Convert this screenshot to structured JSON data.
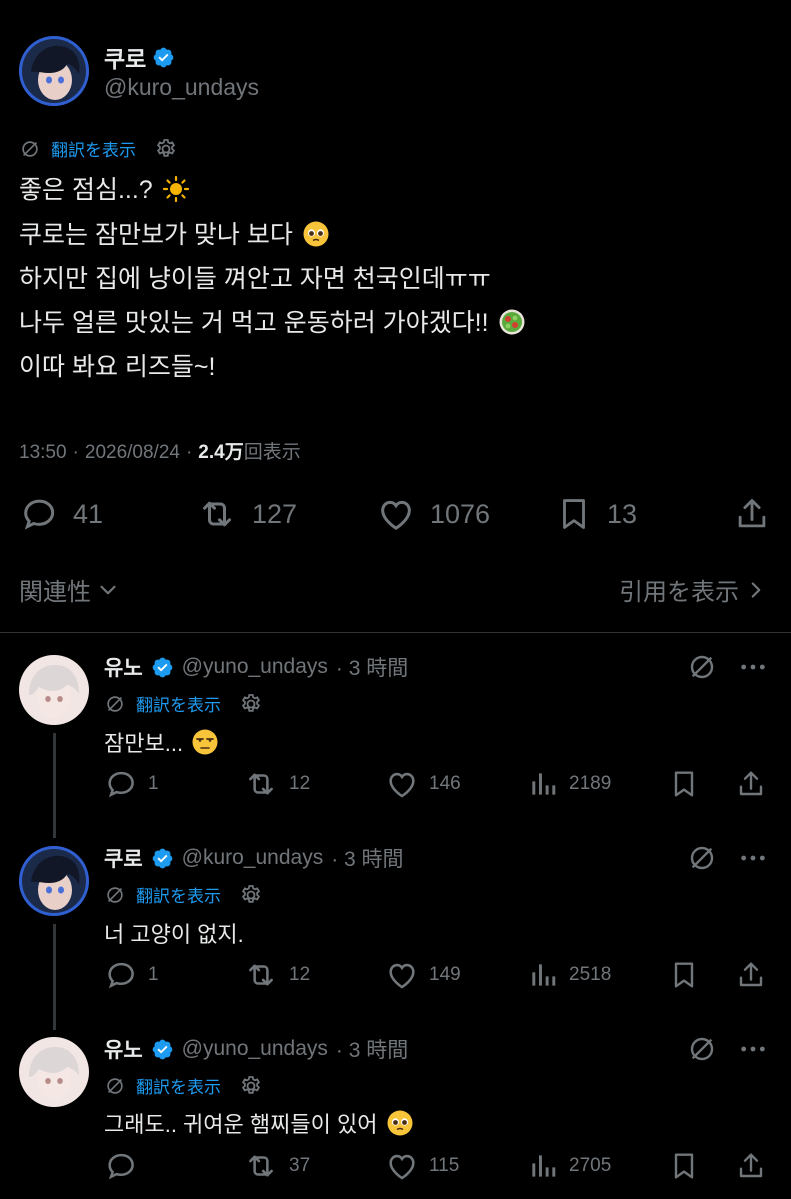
{
  "main_tweet": {
    "author_name": "쿠로",
    "author_handle": "@kuro_undays",
    "translate_label": "翻訳を表示",
    "lines": [
      "좋은 점심...?",
      "쿠로는 잠만보가 맞나 보다",
      "하지만 집에 냥이들 껴안고 자면 천국인데ㅠㅠ",
      "나두 얼른 맛있는 거 먹고 운동하러 가야겠다!!",
      "이따 봐요 리즈들~!"
    ],
    "time": "13:50",
    "date": "2026/08/24",
    "dot": "·",
    "views_count": "2.4万",
    "views_label": "回表示",
    "replies": "41",
    "reposts": "127",
    "likes": "1076",
    "bookmarks": "13"
  },
  "sort": {
    "relevance_label": "関連性",
    "quotes_label": "引用を表示"
  },
  "replies": [
    {
      "name": "유노",
      "handle": "@yuno_undays",
      "time": "· 3 時間",
      "translate_label": "翻訳を表示",
      "text": "잠만보...",
      "replies": "1",
      "reposts": "12",
      "likes": "146",
      "views": "2189"
    },
    {
      "name": "쿠로",
      "handle": "@kuro_undays",
      "time": "· 3 時間",
      "translate_label": "翻訳を表示",
      "text": "너 고양이 없지.",
      "replies": "1",
      "reposts": "12",
      "likes": "149",
      "views": "2518"
    },
    {
      "name": "유노",
      "handle": "@yuno_undays",
      "time": "· 3 時間",
      "translate_label": "翻訳を表示",
      "text": "그래도.. 귀여운 햄찌들이 있어",
      "replies": "",
      "reposts": "37",
      "likes": "115",
      "views": "2705"
    }
  ],
  "colors": {
    "background": "#000000",
    "accent": "#1d9bf0",
    "muted": "#71767b",
    "text": "#e7e9ea"
  }
}
